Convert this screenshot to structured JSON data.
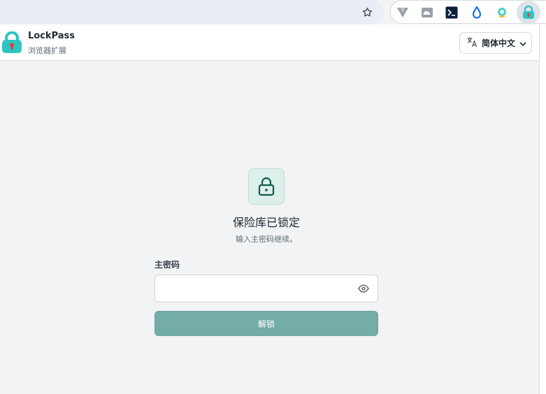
{
  "browser": {
    "extensions": [
      "v-extension-icon",
      "cloud-image-icon",
      "terminal-icon",
      "drop-icon",
      "robot-icon",
      "lockpass-icon"
    ]
  },
  "header": {
    "app_name": "LockPass",
    "app_subtitle": "浏览器扩展",
    "language": "简体中文"
  },
  "main": {
    "title": "保险库已锁定",
    "subtitle": "输入主密码继续。",
    "password_label": "主密码",
    "password_value": "",
    "unlock_label": "解锁"
  },
  "colors": {
    "accent": "#74aca8",
    "brand": "#2ec4c4"
  }
}
